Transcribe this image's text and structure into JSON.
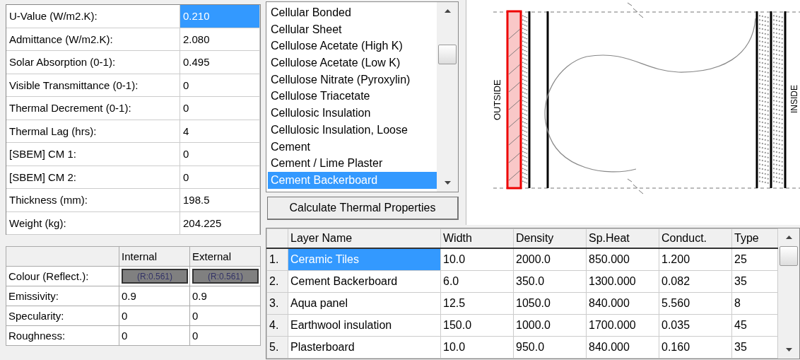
{
  "properties": [
    {
      "label": "U-Value (W/m2.K):",
      "value": "0.210",
      "selected": true
    },
    {
      "label": "Admittance (W/m2.K):",
      "value": "2.080",
      "selected": false
    },
    {
      "label": "Solar Absorption (0-1):",
      "value": "0.495",
      "selected": false
    },
    {
      "label": "Visible Transmittance (0-1):",
      "value": "0",
      "selected": false
    },
    {
      "label": "Thermal Decrement (0-1):",
      "value": "0",
      "selected": false
    },
    {
      "label": "Thermal Lag (hrs):",
      "value": "4",
      "selected": false
    },
    {
      "label": "[SBEM] CM 1:",
      "value": "0",
      "selected": false
    },
    {
      "label": "[SBEM] CM 2:",
      "value": "0",
      "selected": false
    },
    {
      "label": "Thickness (mm):",
      "value": "198.5",
      "selected": false
    },
    {
      "label": "Weight (kg):",
      "value": "204.225",
      "selected": false
    }
  ],
  "surface_table": {
    "columns": [
      "Internal",
      "External"
    ],
    "rows": [
      {
        "kind": "swatch",
        "label": "Colour (Reflect.):",
        "cells": [
          {
            "text": "(R:0.561)",
            "color": "#808080"
          },
          {
            "text": "(R:0.561)",
            "color": "#808080"
          }
        ]
      },
      {
        "kind": "text",
        "label": "Emissivity:",
        "cells": [
          {
            "text": "0.9"
          },
          {
            "text": "0.9"
          }
        ]
      },
      {
        "kind": "text",
        "label": "Specularity:",
        "cells": [
          {
            "text": "0"
          },
          {
            "text": "0"
          }
        ]
      },
      {
        "kind": "text",
        "label": "Roughness:",
        "cells": [
          {
            "text": "0"
          },
          {
            "text": "0"
          }
        ]
      }
    ]
  },
  "materials": [
    {
      "label": "Cellular Bonded",
      "selected": false
    },
    {
      "label": "Cellular Sheet",
      "selected": false
    },
    {
      "label": "Cellulose Acetate (High K)",
      "selected": false
    },
    {
      "label": "Cellulose Acetate (Low K)",
      "selected": false
    },
    {
      "label": "Cellulose Nitrate (Pyroxylin)",
      "selected": false
    },
    {
      "label": "Cellulose Triacetate",
      "selected": false
    },
    {
      "label": "Cellulosic Insulation",
      "selected": false
    },
    {
      "label": "Cellulosic Insulation, Loose",
      "selected": false
    },
    {
      "label": "Cement",
      "selected": false
    },
    {
      "label": "Cement / Lime Plaster",
      "selected": false
    },
    {
      "label": "Cement Backerboard",
      "selected": true
    }
  ],
  "calculate_button": "Calculate Thermal Properties",
  "section_drawing": {
    "outside_label": "OUTSIDE",
    "inside_label": "INSIDE"
  },
  "layers_table": {
    "columns": [
      "Layer Name",
      "Width",
      "Density",
      "Sp.Heat",
      "Conduct.",
      "Type"
    ],
    "rows": [
      {
        "index": "1.",
        "selected": true,
        "cells": [
          "Ceramic Tiles",
          "10.0",
          "2000.0",
          "850.000",
          "1.200",
          "25"
        ]
      },
      {
        "index": "2.",
        "selected": false,
        "cells": [
          "Cement Backerboard",
          "6.0",
          "350.0",
          "1300.000",
          "0.082",
          "35"
        ]
      },
      {
        "index": "3.",
        "selected": false,
        "cells": [
          "Aqua panel",
          "12.5",
          "1050.0",
          "840.000",
          "5.560",
          "8"
        ]
      },
      {
        "index": "4.",
        "selected": false,
        "cells": [
          "Earthwool insulation",
          "150.0",
          "1000.0",
          "1700.000",
          "0.035",
          "45"
        ]
      },
      {
        "index": "5.",
        "selected": false,
        "cells": [
          "Plasterboard",
          "10.0",
          "950.0",
          "840.000",
          "0.160",
          "35"
        ]
      }
    ]
  }
}
